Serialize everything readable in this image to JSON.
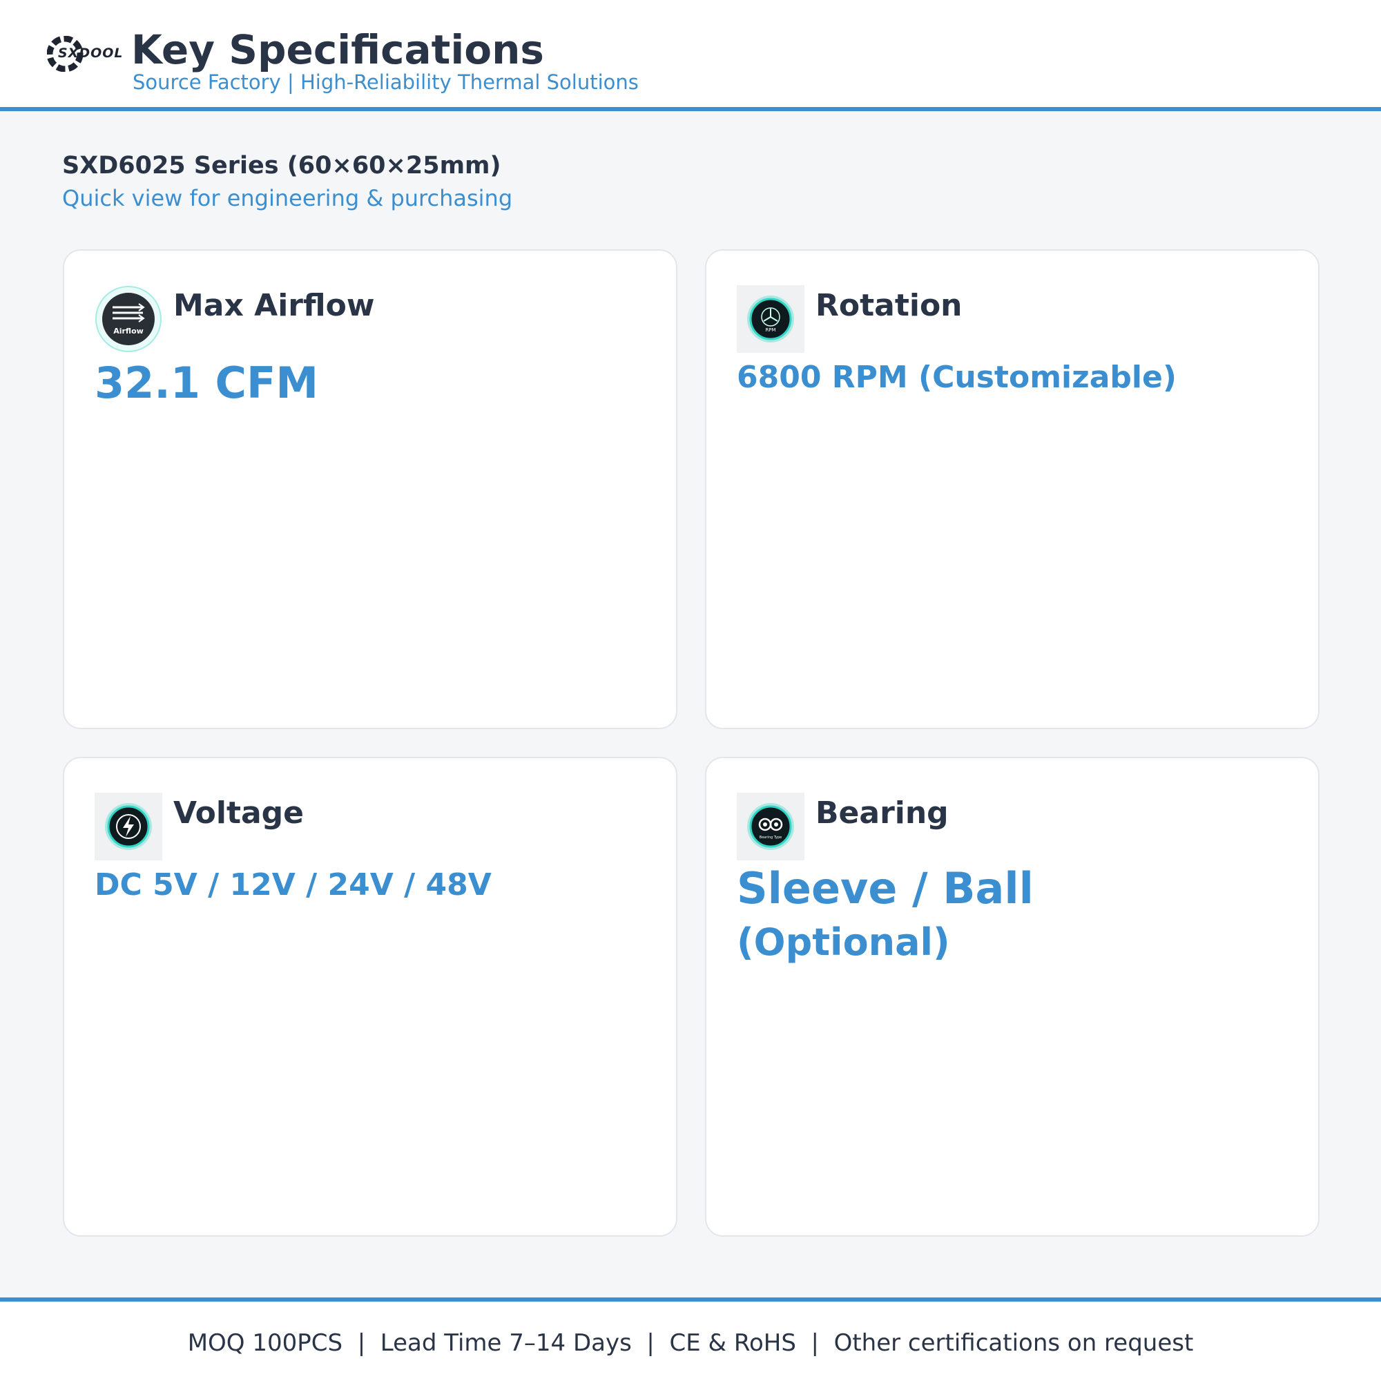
{
  "header": {
    "logo_text": "SXDOOL",
    "title": "Key Specifications",
    "tagline": "Source Factory | High-Reliability Thermal Solutions"
  },
  "series": {
    "title": "SXD6025 Series (60×60×25mm)",
    "subtitle": "Quick view for engineering & purchasing"
  },
  "cards": [
    {
      "label": "Max Airflow",
      "value": "32.1 CFM",
      "icon": "airflow-icon",
      "icon_text": "Airflow"
    },
    {
      "label": "Rotation",
      "value": "6800 RPM (Customizable)",
      "icon": "fan-rpm-icon",
      "icon_text": "RPM"
    },
    {
      "label": "Voltage",
      "value": "DC 5V / 12V / 24V / 48V",
      "icon": "lightning-icon"
    },
    {
      "label": "Bearing",
      "value_line1": "Sleeve / Ball",
      "value_line2": "(Optional)",
      "icon": "bearing-icon",
      "icon_text": "Bearing Type"
    }
  ],
  "footer": {
    "text": "MOQ 100PCS  |  Lead Time 7–14 Days  |  CE & RoHS  |  Other certifications on request"
  },
  "colors": {
    "accent": "#3b8fd0",
    "text": "#2a3447",
    "background": "#f5f6f8",
    "icon_glow": "#2fd6c5"
  }
}
